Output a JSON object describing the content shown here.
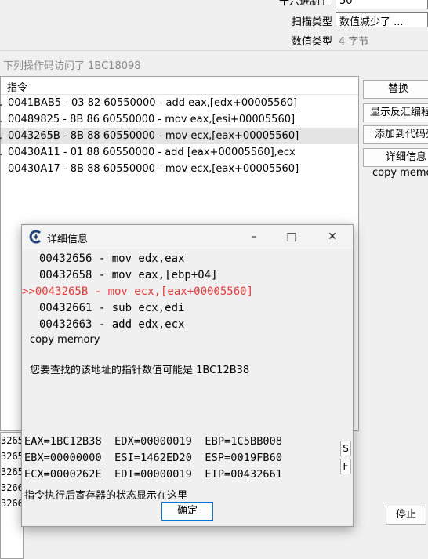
{
  "background": {
    "hex_label": "十六进制",
    "hex_value": "50",
    "scan_type_label": "扫描类型",
    "scan_type_value": "数值减少了 ...",
    "value_type_label": "数值类型",
    "value_type_value": "4 字节"
  },
  "main": {
    "title": "下列操作码访问了 1BC18098",
    "column_header": "指令",
    "rows": [
      {
        "text": "0041BAB5 - 03 82 60550000  - add eax,[edx+00005560]"
      },
      {
        "text": "00489825 - 8B 86 60550000  - mov eax,[esi+00005560]"
      },
      {
        "text": "0043265B - 8B 88 60550000  - mov ecx,[eax+00005560]"
      },
      {
        "text": "00430A11 - 01 88 60550000  - add [eax+00005560],ecx"
      },
      {
        "text": "00430A17 - 8B 88 60550000  - mov ecx,[eax+00005560]"
      }
    ],
    "buttons": {
      "replace": "替换",
      "show_disasm": "显示反汇编程序",
      "add_to_codelist": "添加到代码列表",
      "details": "详细信息",
      "stop": "停止"
    },
    "copy_memory": "copy memory",
    "stub_rows": [
      "3265",
      "3265",
      "3265",
      "3266",
      "3266"
    ]
  },
  "dialog": {
    "title": "详细信息",
    "asm_lines": [
      {
        "text": "00432656 - mov edx,eax",
        "highlight": false
      },
      {
        "text": "00432658 - mov eax,[ebp+04]",
        "highlight": false
      },
      {
        "text": ">>0043265B - mov ecx,[eax+00005560]",
        "highlight": true
      },
      {
        "text": "00432661 - sub ecx,edi",
        "highlight": false
      },
      {
        "text": "00432663 - add edx,ecx",
        "highlight": false
      }
    ],
    "copy_memory": "copy memory",
    "pointer_hint": "您要查找的该地址的指针数值可能是 1BC12B38",
    "registers": [
      "EAX=1BC12B38  EDX=00000019  EBP=1C5BB008",
      "EBX=00000000  ESI=1462ED20  ESP=0019FB60",
      "ECX=0000262E  EDI=00000019  EIP=00432661"
    ],
    "s_button": "S",
    "f_button": "F",
    "status_note": "指令执行后寄存器的状态显示在这里",
    "ok_button": "确定",
    "highlight_color": "#e23b3b"
  }
}
